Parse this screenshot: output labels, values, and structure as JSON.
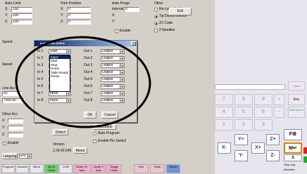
{
  "top": {
    "auto_limit": {
      "title": "Auto Limit",
      "x_label": "X:",
      "x_value": "200",
      "y_label": "Y:",
      "y_value": "200",
      "z_label": "Z:",
      "z_value": "100"
    },
    "park": {
      "title": "Park Position",
      "x_label": "X:",
      "x_value": "0",
      "y_label": "Y:",
      "y_value": "0",
      "z_label": "Z:",
      "z_value": "0"
    },
    "auto_purge": {
      "title": "Auto Purge",
      "interval_label": "Interval",
      "interval_value": "0",
      "x_label": "X:",
      "y_label": "Y:",
      "enable_label": "Enable"
    },
    "other": {
      "title": "Other",
      "recycle_label": "Re-cycle Validator",
      "tip_detect_label": "Tip Detect Device",
      "z_code_label": "Z2 Code",
      "needles_label": "2 Needles"
    },
    "exit_label": "Exit"
  },
  "left": {
    "speed_title": "Speed",
    "speed_label": "Speed",
    "line_acc_label": "Line Acc",
    "line_acc_value": "50",
    "max_speed_value": "7000.00",
    "other_acc_title": "Other Acc",
    "x_label": "X:",
    "y_label": "Y:",
    "z_label": "Z:",
    "enable_label": "Enable"
  },
  "bottom_left": {
    "language_label": "Language",
    "language_value": "EN",
    "detect_label": "Detect",
    "version_title": "Version",
    "version_value": "2.29.42.646",
    "about_label": "About",
    "backtrack_label": "Backtrack",
    "auto_program_label": "Auto Program",
    "enable_switch_label": "Enable Pin Switch"
  },
  "dialog": {
    "title": "In Function Define",
    "rows": [
      {
        "in_label": "In 1",
        "in_value": "Start",
        "out_label": "Out 1",
        "out_value": "Output"
      },
      {
        "in_label": "In 2",
        "in_value": "Input",
        "out_label": "Out 2",
        "out_value": "Output"
      },
      {
        "in_label": "In 3",
        "in_value": "Input",
        "out_label": "Out 3",
        "out_value": "Output"
      },
      {
        "in_label": "In 4",
        "in_value": "Input",
        "out_label": "Out 4",
        "out_value": "Output"
      },
      {
        "in_label": "In 5",
        "in_value": "Input",
        "out_label": "Out 5",
        "out_value": "Output"
      },
      {
        "in_label": "In 6",
        "in_value": "Pause",
        "out_label": "Out 6",
        "out_value": "Output"
      },
      {
        "in_label": "In 7",
        "in_value": "Input",
        "out_label": "Out 7",
        "out_value": "Output"
      },
      {
        "in_label": "In 8",
        "in_value": "Input",
        "out_label": "Out 8",
        "out_value": "Output"
      }
    ],
    "dropdown_options": [
      "Input",
      "Start",
      "Stop",
      "Home",
      "Table Ready",
      "Pause"
    ],
    "dropdown_selected": "Input",
    "ok_label": "OK",
    "cancel_label": "Cancel"
  },
  "keypad": {
    "clear_label": "Clear",
    "esc_label": "Esc",
    "next_label": "Next Name",
    "keys": [
      "7",
      "8",
      "9",
      "4",
      "5",
      "6",
      "1",
      "2",
      "3"
    ],
    "minus_label": "-",
    "enter_label": "Enter"
  },
  "jog": {
    "x_minus": "X-",
    "x_plus": "X+",
    "y_plus": "Y+",
    "y_minus": "Y-",
    "z_plus": "Z+",
    "z_minus": "Z-",
    "f_label": "F",
    "m_label": "M",
    "s_label": "S",
    "step_label": "Step Jog",
    "absolute_label": "Absolute"
  },
  "toolbar": {
    "items": [
      "Program",
      "Camera",
      "Mirror",
      "Set to Cycle",
      "CCW",
      "Mode XY Auto",
      "Mode Z Auto",
      "Toggle Finder",
      "Run",
      "Clear",
      "Pause"
    ]
  },
  "colors": {
    "title_bar": "#0a246a",
    "ellipse": "#000000",
    "keypad_text": "#8a86a8",
    "jog_blue": "#1d3fa8",
    "status_red": "#e02020",
    "status_green": "#20b020"
  }
}
